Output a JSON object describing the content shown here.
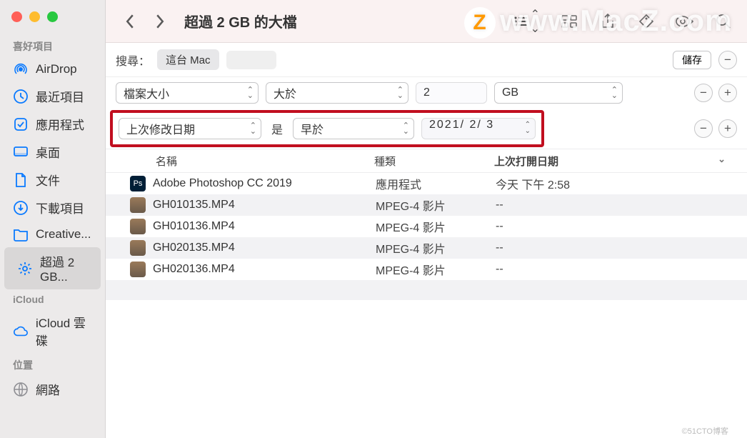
{
  "watermark": {
    "z": "Z",
    "text": "www.MacZ.com"
  },
  "credit": "©51CTO博客",
  "window_title": "超過 2 GB 的大檔",
  "sidebar": {
    "sections": [
      {
        "head": "喜好項目",
        "items": [
          {
            "label": "AirDrop",
            "icon": "airdrop"
          },
          {
            "label": "最近項目",
            "icon": "clock"
          },
          {
            "label": "應用程式",
            "icon": "app"
          },
          {
            "label": "桌面",
            "icon": "desktop"
          },
          {
            "label": "文件",
            "icon": "doc"
          },
          {
            "label": "下載項目",
            "icon": "download"
          },
          {
            "label": "Creative...",
            "icon": "folder"
          },
          {
            "label": "超過 2 GB...",
            "icon": "gear",
            "selected": true
          }
        ]
      },
      {
        "head": "iCloud",
        "items": [
          {
            "label": "iCloud 雲碟",
            "icon": "cloud"
          }
        ]
      },
      {
        "head": "位置",
        "items": [
          {
            "label": "網路",
            "icon": "globe",
            "dim": true
          }
        ]
      }
    ]
  },
  "searchbar": {
    "label": "搜尋：",
    "scope_tab": "這台 Mac",
    "save_btn": "儲存"
  },
  "criteria": {
    "row1": {
      "attr": "檔案大小",
      "op": "大於",
      "val": "2",
      "unit": "GB"
    },
    "row2": {
      "attr": "上次修改日期",
      "is": "是",
      "op": "早於",
      "date": "2021/  2/  3"
    }
  },
  "columns": {
    "name": "名稱",
    "kind": "種類",
    "open": "上次打開日期"
  },
  "files": [
    {
      "icon": "ps",
      "ic_txt": "Ps",
      "name": "Adobe Photoshop CC 2019",
      "kind": "應用程式",
      "open": "今天 下午 2:58",
      "alt": false
    },
    {
      "icon": "mp",
      "ic_txt": "",
      "name": "GH010135.MP4",
      "kind": "MPEG-4 影片",
      "open": "--",
      "alt": true
    },
    {
      "icon": "mp",
      "ic_txt": "",
      "name": "GH010136.MP4",
      "kind": "MPEG-4 影片",
      "open": "--",
      "alt": false
    },
    {
      "icon": "mp",
      "ic_txt": "",
      "name": "GH020135.MP4",
      "kind": "MPEG-4 影片",
      "open": "--",
      "alt": true
    },
    {
      "icon": "mp",
      "ic_txt": "",
      "name": "GH020136.MP4",
      "kind": "MPEG-4 影片",
      "open": "--",
      "alt": false
    }
  ]
}
